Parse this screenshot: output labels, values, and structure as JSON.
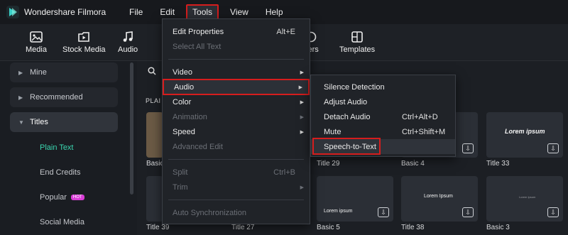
{
  "app": {
    "name": "Wondershare Filmora"
  },
  "menubar": {
    "items": [
      "File",
      "Edit",
      "Tools",
      "View",
      "Help"
    ]
  },
  "toolbar": {
    "items": [
      "Media",
      "Stock Media",
      "Audio",
      "kers",
      "Templates"
    ]
  },
  "sidebar": {
    "items": [
      {
        "label": "Mine"
      },
      {
        "label": "Recommended"
      },
      {
        "label": "Titles"
      }
    ],
    "subitems": [
      "Plain Text",
      "End Credits",
      "Popular",
      "Social Media"
    ],
    "hot_badge": "HOT"
  },
  "content": {
    "section_label": "PLAI",
    "cards": [
      {
        "label": "Basic",
        "thumb": ""
      },
      {
        "label": "Title 29",
        "thumb": ""
      },
      {
        "label": "Basic 4",
        "thumb": ""
      },
      {
        "label": "Title 33",
        "thumb": "Lorem ipsum"
      },
      {
        "label": "Title 39",
        "thumb": ""
      },
      {
        "label": "Title 27",
        "thumb": ""
      },
      {
        "label": "Basic 5",
        "thumb": "Lorem ipsum"
      },
      {
        "label": "Title 38",
        "thumb": "Lorem Ipsum"
      },
      {
        "label": "Basic 3",
        "thumb": "Lorem Ipsum"
      }
    ]
  },
  "tools_menu": {
    "items": [
      {
        "label": "Edit Properties",
        "shortcut": "Alt+E",
        "disabled": false
      },
      {
        "label": "Select All Text",
        "shortcut": "",
        "disabled": true
      },
      {
        "label": "Video",
        "shortcut": "",
        "disabled": false
      },
      {
        "label": "Audio",
        "shortcut": "",
        "disabled": false
      },
      {
        "label": "Color",
        "shortcut": "",
        "disabled": false
      },
      {
        "label": "Animation",
        "shortcut": "",
        "disabled": true
      },
      {
        "label": "Speed",
        "shortcut": "",
        "disabled": false
      },
      {
        "label": "Advanced Edit",
        "shortcut": "",
        "disabled": true
      },
      {
        "label": "Split",
        "shortcut": "Ctrl+B",
        "disabled": true
      },
      {
        "label": "Trim",
        "shortcut": "",
        "disabled": true
      },
      {
        "label": "Auto Synchronization",
        "shortcut": "",
        "disabled": true
      }
    ]
  },
  "audio_submenu": {
    "items": [
      {
        "label": "Silence Detection",
        "shortcut": ""
      },
      {
        "label": "Adjust Audio",
        "shortcut": ""
      },
      {
        "label": "Detach Audio",
        "shortcut": "Ctrl+Alt+D"
      },
      {
        "label": "Mute",
        "shortcut": "Ctrl+Shift+M"
      },
      {
        "label": "Speech-to-Text",
        "shortcut": ""
      }
    ]
  },
  "colors": {
    "highlight_red": "#d61d1d",
    "accent_teal": "#3ad6b0",
    "hot_pink": "#d93dd6"
  }
}
